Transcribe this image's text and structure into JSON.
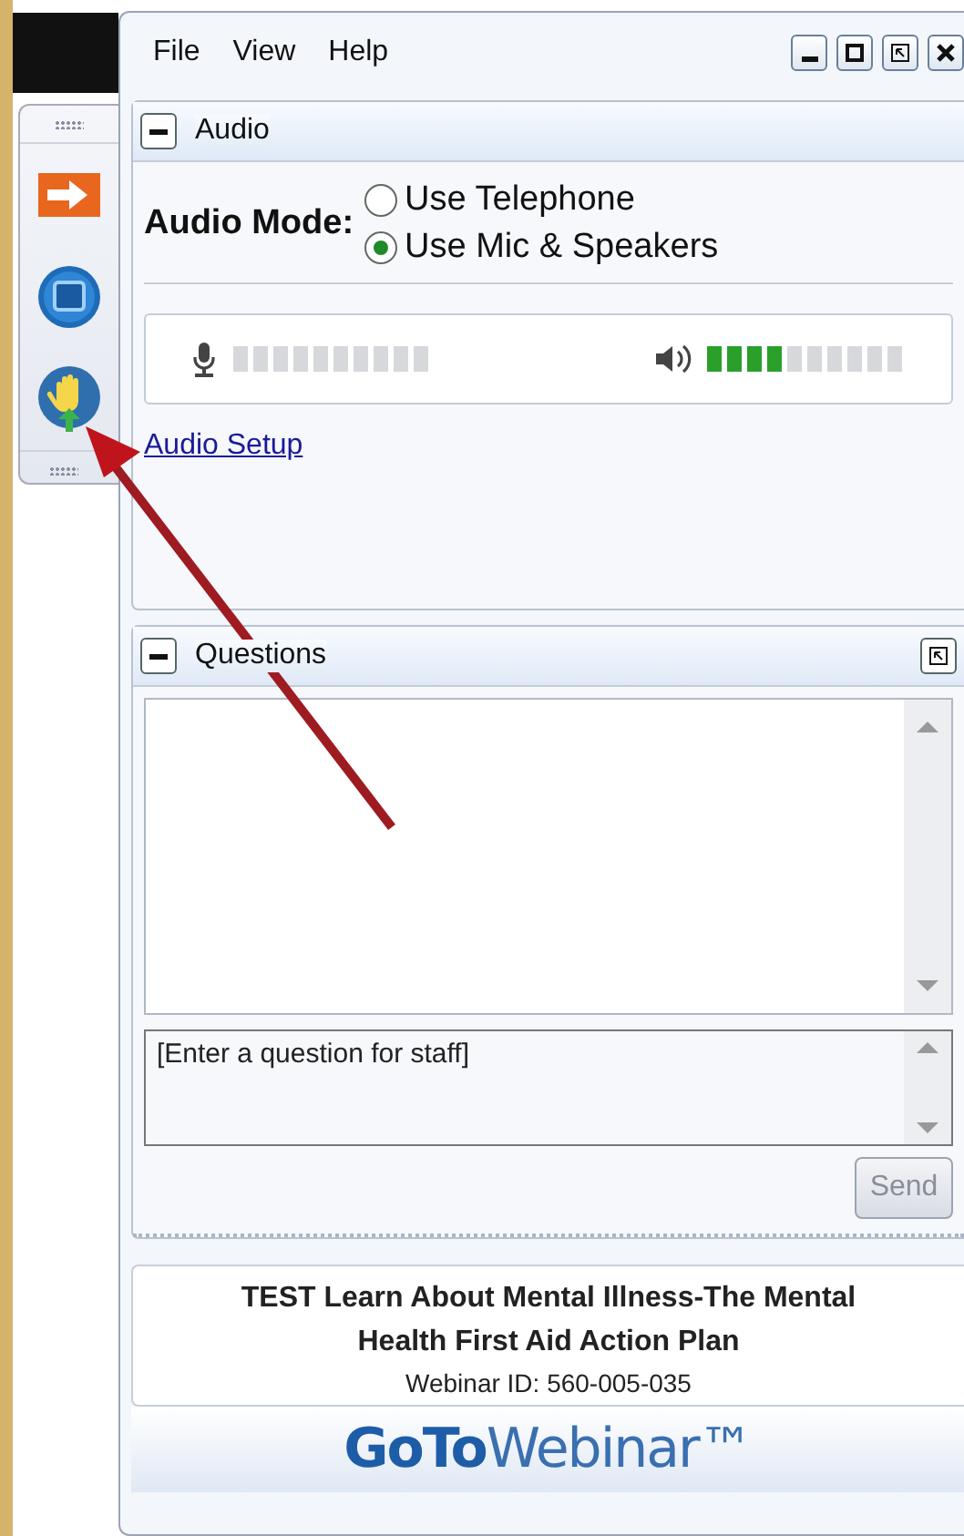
{
  "menu": [
    {
      "label": "File"
    },
    {
      "label": "View"
    },
    {
      "label": "Help"
    }
  ],
  "audio": {
    "title": "Audio",
    "expanded": true,
    "mode_label": "Audio Mode:",
    "options": [
      {
        "label": "Use Telephone",
        "selected": false
      },
      {
        "label": "Use Mic & Speakers",
        "selected": true
      }
    ],
    "microphone": {
      "level": 0
    },
    "speaker": {
      "level": 0.4
    },
    "setup_link": "Audio Setup"
  },
  "questions": {
    "title": "Questions",
    "expanded": true,
    "placeholder": "[Enter a question for staff]",
    "send": {
      "label": "Send",
      "disabled": true
    }
  },
  "footer": {
    "title": "TEST Learn About Mental Illness-The Mental Health First Aid Action Plan",
    "webinar_id": "Webinar ID: 560-005-035",
    "logo": "**GoTo**Webinar™"
  }
}
